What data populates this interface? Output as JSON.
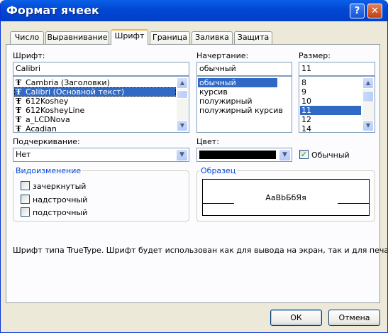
{
  "window": {
    "title": "Формат ячеек",
    "help_glyph": "?",
    "close_glyph": "✕"
  },
  "tabs": [
    {
      "label": "Число"
    },
    {
      "label": "Выравнивание"
    },
    {
      "label": "Шрифт",
      "active": true
    },
    {
      "label": "Граница"
    },
    {
      "label": "Заливка"
    },
    {
      "label": "Защита"
    }
  ],
  "font": {
    "label": "Шрифт:",
    "value": "Calibri",
    "items": [
      "Cambria (Заголовки)",
      "Calibri (Основной текст)",
      "612Koshey",
      "612KosheyLine",
      "a_LCDNova",
      "Acadian"
    ],
    "selected_index": 1,
    "icon_glyph": "Ŧ"
  },
  "style": {
    "label": "Начертание:",
    "value": "обычный",
    "items": [
      "обычный",
      "курсив",
      "полужирный",
      "полужирный курсив"
    ],
    "selected_index": 0
  },
  "size": {
    "label": "Размер:",
    "value": "11",
    "items": [
      "8",
      "9",
      "10",
      "11",
      "12",
      "14"
    ],
    "selected_index": 3
  },
  "underline": {
    "label": "Подчеркивание:",
    "value": "Нет"
  },
  "color": {
    "label": "Цвет:",
    "swatch": "#000000"
  },
  "normal_font": {
    "label": "Обычный",
    "checked": true
  },
  "effects": {
    "legend": "Видоизменение",
    "strikethrough": "зачеркнутый",
    "superscript": "надстрочный",
    "subscript": "подстрочный"
  },
  "preview": {
    "legend": "Образец",
    "sample": "AaBbБбЯя"
  },
  "info_text": "Шрифт типа TrueType. Шрифт будет использован как для вывода на экран, так и для печати.",
  "buttons": {
    "ok": "ОК",
    "cancel": "Отмена"
  },
  "icons": {
    "up": "▲",
    "down": "▼",
    "check": "✓"
  },
  "colors": {
    "titlebar": "#0247d3",
    "selection": "#316ac5",
    "dialog": "#ece9d8",
    "accent": "#0046d5"
  }
}
